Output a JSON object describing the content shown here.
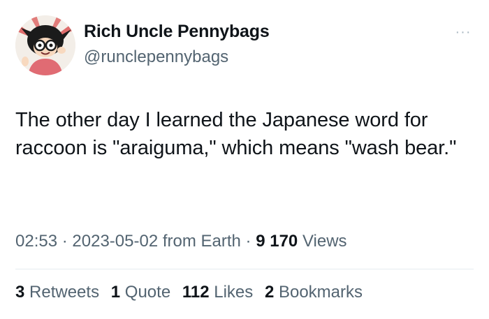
{
  "tweet": {
    "display_name": "Rich Uncle Pennybags",
    "handle": "@runclepennybags",
    "more_icon": "···",
    "text": "The other day I learned the Japanese word for raccoon is \"araiguma,\" which means \"wash bear.\"",
    "time": "02:53",
    "sep": "·",
    "date": "2023-05-02",
    "source": "from Earth",
    "views_count": "9 170",
    "views_label": "Views",
    "stats": {
      "retweets_count": "3",
      "retweets_label": "Retweets",
      "quotes_count": "1",
      "quotes_label": "Quote",
      "likes_count": "112",
      "likes_label": "Likes",
      "bookmarks_count": "2",
      "bookmarks_label": "Bookmarks"
    }
  },
  "icons": {
    "avatar": "avatar-image",
    "more": "more-options-icon"
  },
  "colors": {
    "text": "#0f1419",
    "secondary": "#536471",
    "divider": "#e6ecf0"
  }
}
